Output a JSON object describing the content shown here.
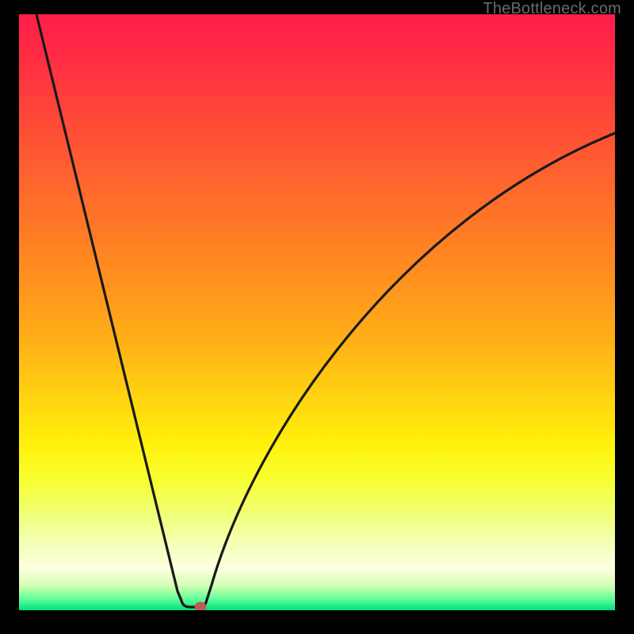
{
  "watermark": "TheBottleneck.com",
  "colors": {
    "frame": "#000000",
    "curve": "#1a1a1a",
    "marker": "#c05a50",
    "gradient_top": "#ff1e4a",
    "gradient_bottom": "#00e080"
  },
  "chart_data": {
    "type": "line",
    "title": "",
    "xlabel": "",
    "ylabel": "",
    "xlim": [
      0,
      100
    ],
    "ylim": [
      0,
      100
    ],
    "grid": false,
    "legend": false,
    "annotations": [
      "TheBottleneck.com"
    ],
    "min_point": {
      "x": 28,
      "y": 0
    },
    "series": [
      {
        "name": "bottleneck-curve",
        "x": [
          0,
          5,
          10,
          15,
          20,
          23,
          25,
          27,
          28,
          29,
          31,
          34,
          38,
          43,
          50,
          58,
          67,
          77,
          88,
          100
        ],
        "y": [
          100,
          84,
          67,
          49,
          30,
          18,
          10,
          3,
          0,
          0,
          5,
          13,
          23,
          33,
          44,
          54,
          62,
          69,
          75,
          80
        ]
      }
    ]
  }
}
